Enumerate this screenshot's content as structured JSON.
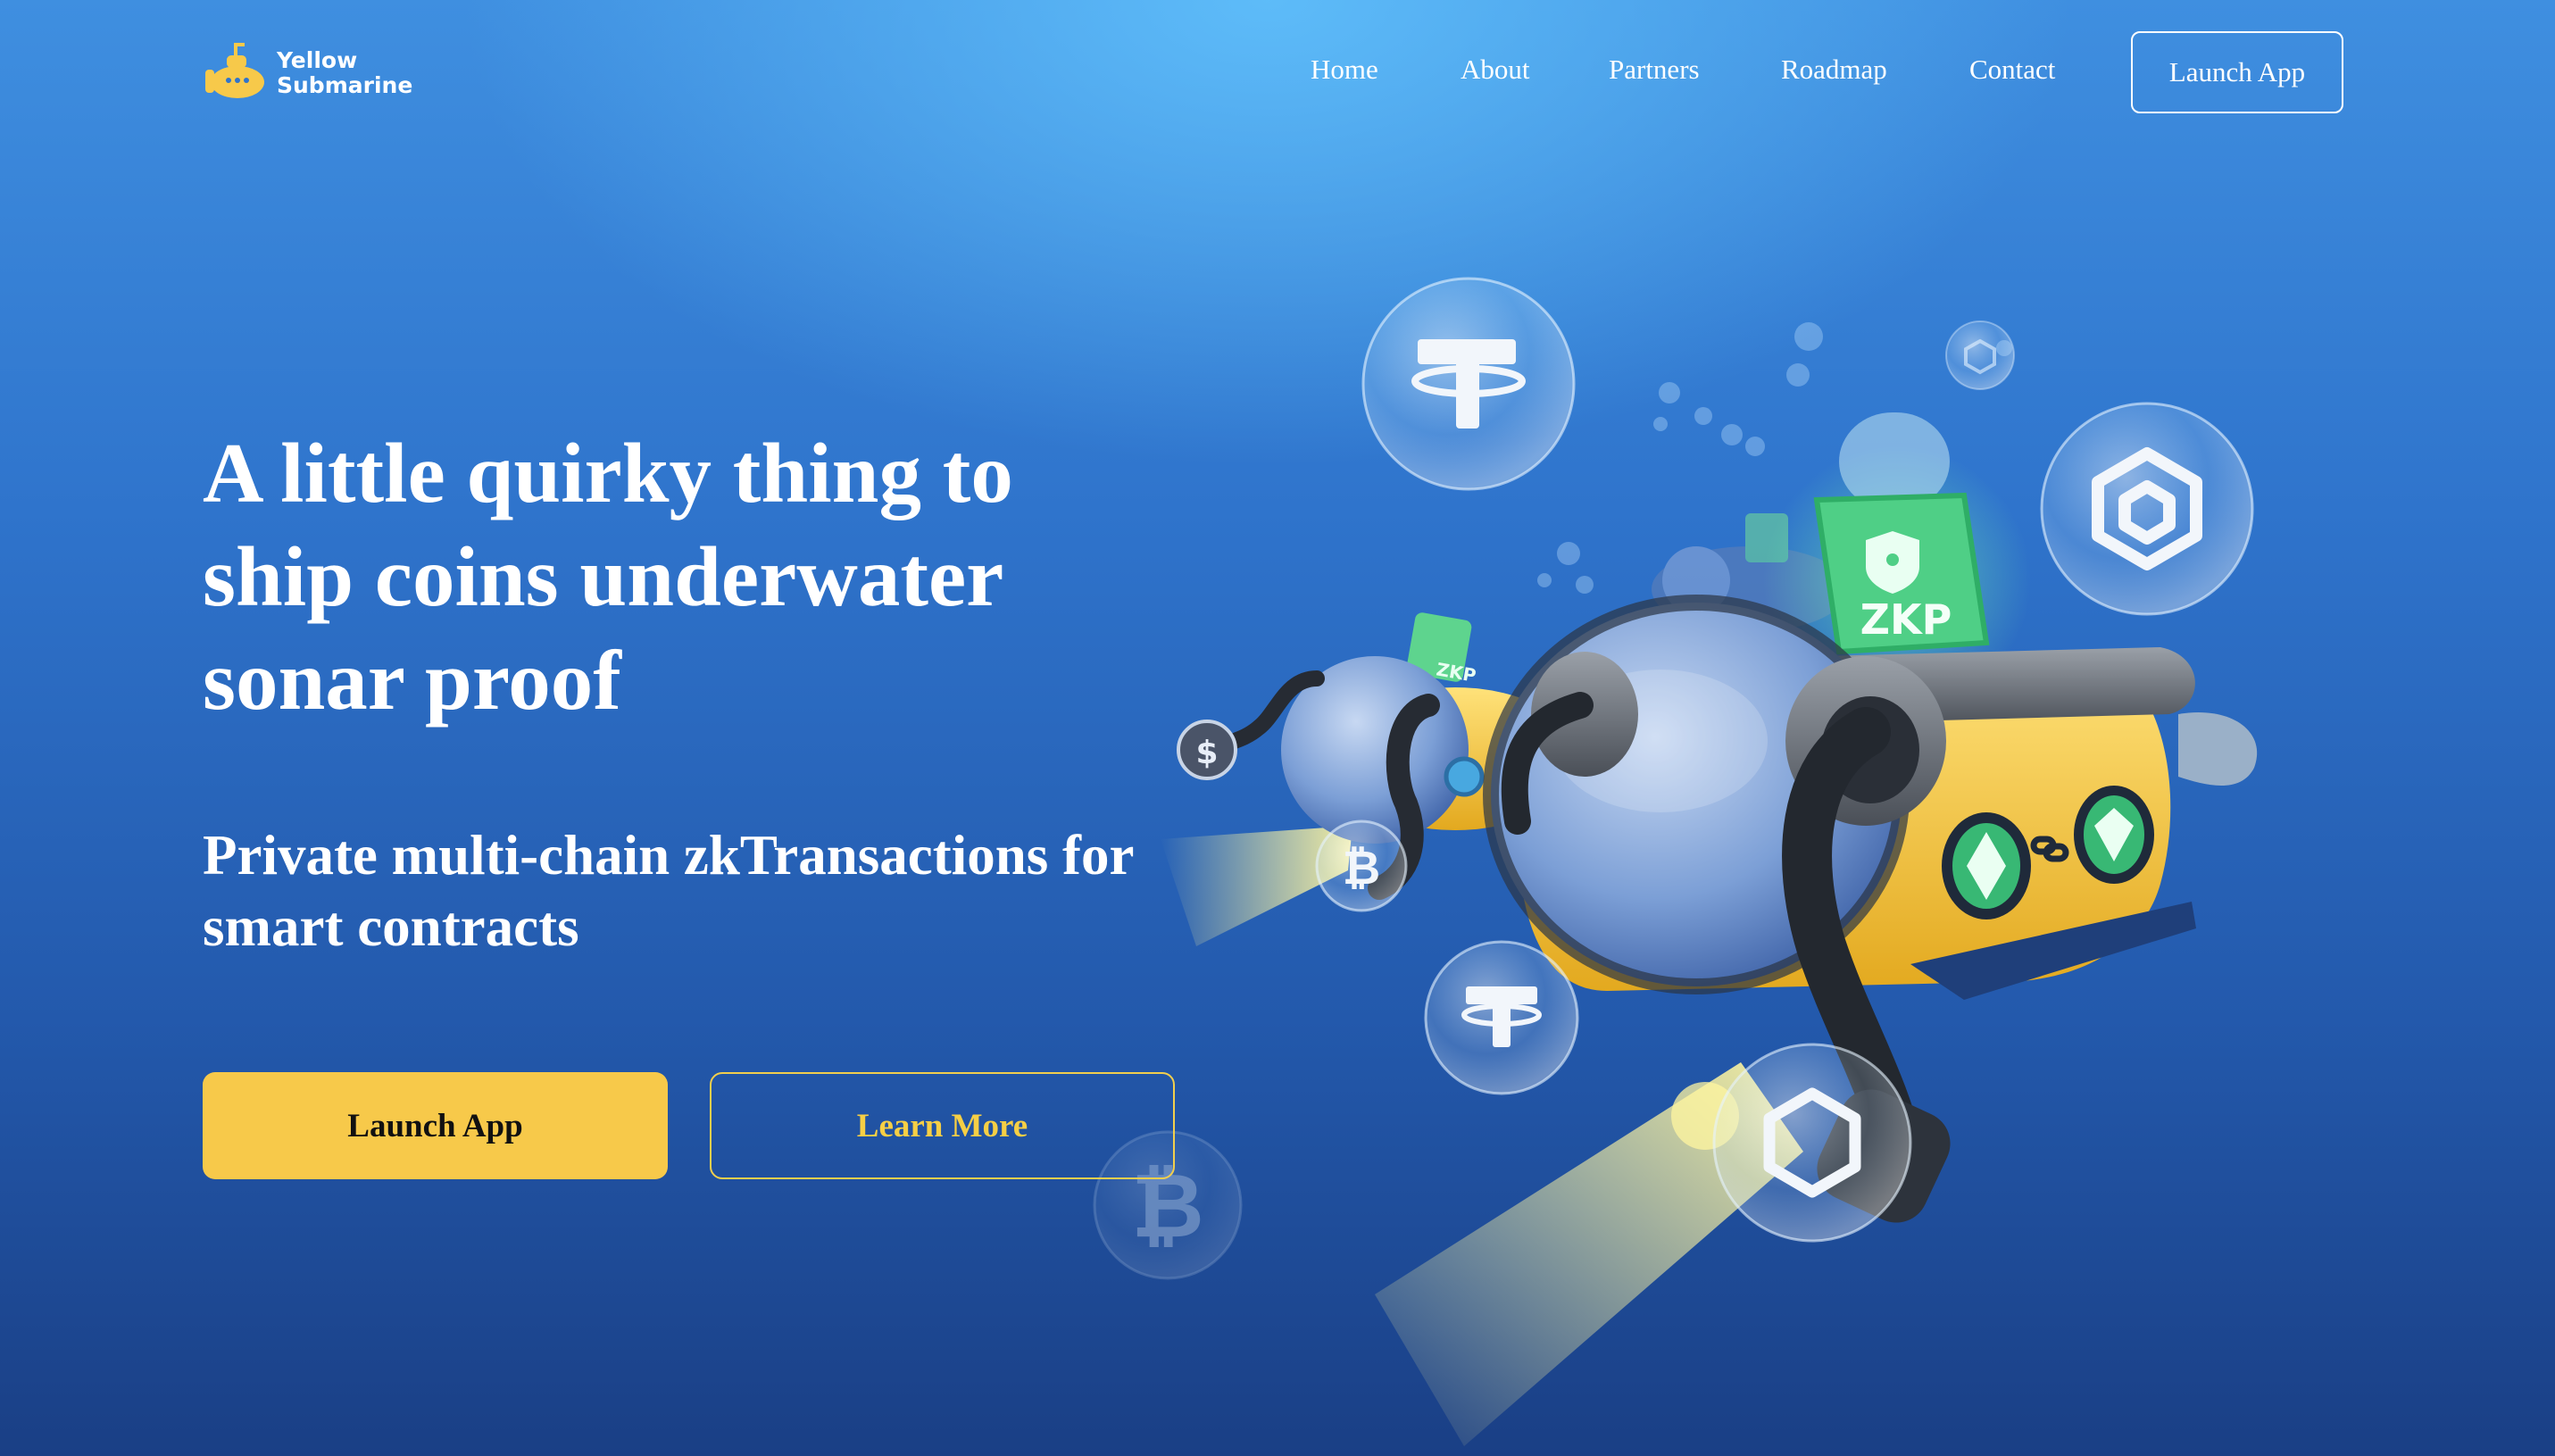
{
  "brand": {
    "name_line1": "Yellow",
    "name_line2": "Submarine",
    "logo_icon": "submarine-icon",
    "accent": "#f7c94a"
  },
  "nav": {
    "items": [
      "Home",
      "About",
      "Partners",
      "Roadmap",
      "Contact"
    ],
    "launch_label": "Launch App"
  },
  "hero": {
    "title": "A little quirky thing to ship coins underwater sonar proof",
    "subtitle": "Private multi-chain zkTransactions for smart contracts",
    "primary_label": "Launch App",
    "secondary_label": "Learn More"
  },
  "illustration": {
    "badge_text": "ZKP",
    "badge_text_small": "ZKP",
    "coin_icons": [
      "tether-icon",
      "bnb-icon",
      "bitcoin-icon",
      "dollar-icon",
      "ethereum-icon",
      "ethereum-classic-icon",
      "chain-link-icon"
    ]
  },
  "colors": {
    "background_top": "#5fbefa",
    "background_bottom": "#1a3f85",
    "button_yellow": "#f7c94a",
    "zkp_green": "#5fd38d"
  }
}
